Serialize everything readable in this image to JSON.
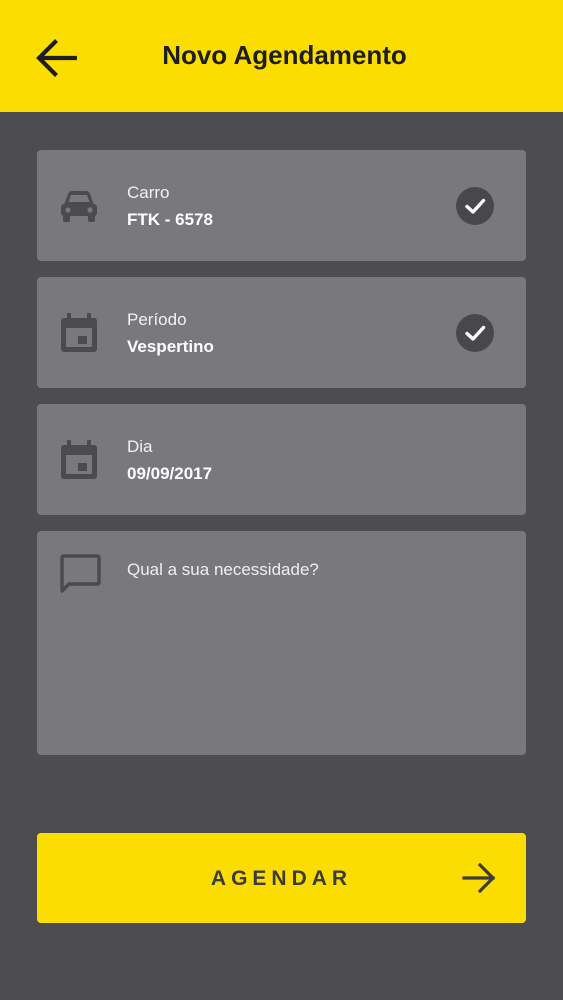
{
  "header": {
    "title": "Novo Agendamento",
    "back_icon": "arrow-left-icon",
    "color": "#fbdd00"
  },
  "cards": {
    "car": {
      "icon": "car-icon",
      "label": "Carro",
      "value": "FTK - 6578",
      "checked": true
    },
    "period": {
      "icon": "calendar-icon",
      "label": "Período",
      "value": "Vespertino",
      "checked": true
    },
    "day": {
      "icon": "calendar-icon",
      "label": "Dia",
      "value": "09/09/2017",
      "checked": false
    },
    "need": {
      "icon": "chat-bubble-icon",
      "placeholder": "Qual a sua necessidade?"
    }
  },
  "submit": {
    "label": "AGENDAR",
    "icon": "arrow-right-icon"
  },
  "colors": {
    "background": "#4d4d4f",
    "card": "#79787c",
    "accent": "#fbdd00",
    "icon": "#4b4b4e"
  }
}
